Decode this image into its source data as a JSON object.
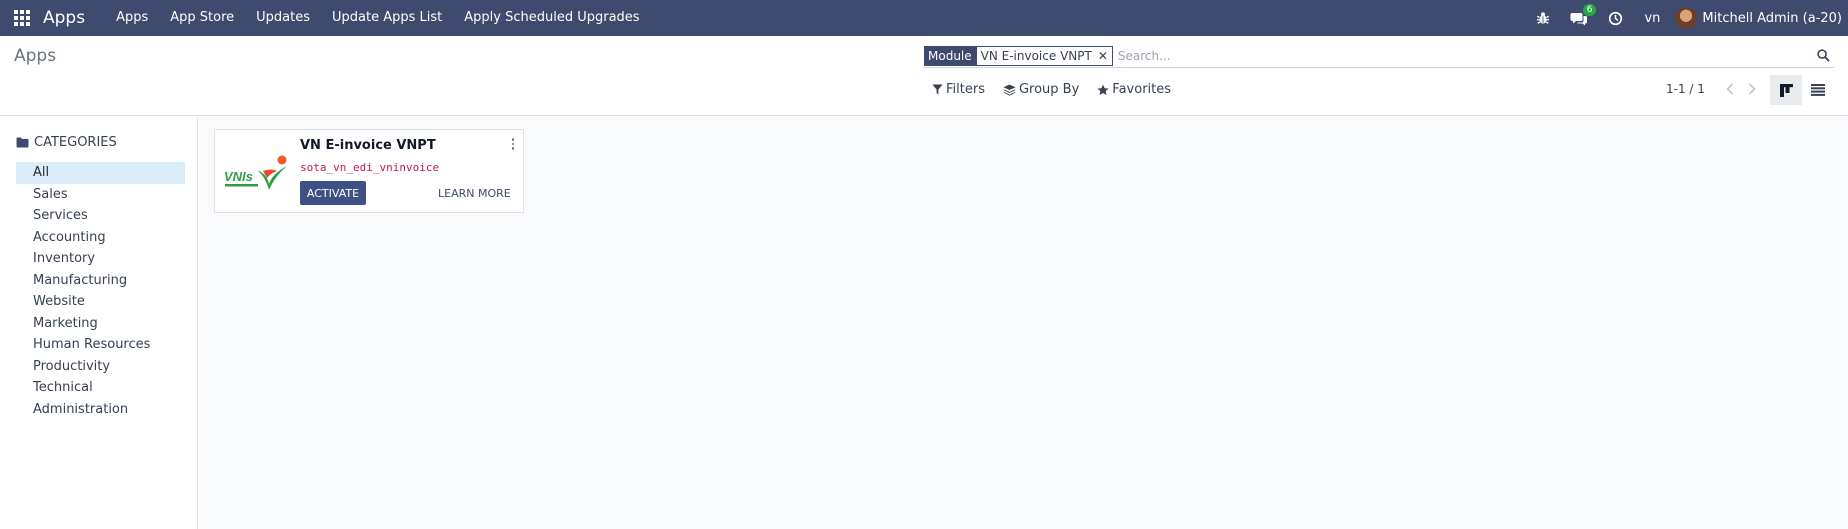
{
  "navbar": {
    "brand": "Apps",
    "menu": [
      "Apps",
      "App Store",
      "Updates",
      "Update Apps List",
      "Apply Scheduled Upgrades"
    ],
    "messages_badge": "6",
    "lang": "vn",
    "user_name": "Mitchell Admin (a-20)",
    "icons": [
      "app-grid-icon",
      "bug-icon",
      "chat-icon",
      "clock-icon"
    ]
  },
  "control": {
    "page_title": "Apps",
    "facet_label": "Module",
    "facet_value": "VN E-invoice VNPT",
    "search_placeholder": "Search...",
    "filters_label": "Filters",
    "groupby_label": "Group By",
    "favorites_label": "Favorites",
    "pager_value": "1-1 / 1"
  },
  "sidebar": {
    "header": "CATEGORIES",
    "items": [
      {
        "label": "All",
        "active": true
      },
      {
        "label": "Sales"
      },
      {
        "label": "Services"
      },
      {
        "label": "Accounting"
      },
      {
        "label": "Inventory"
      },
      {
        "label": "Manufacturing"
      },
      {
        "label": "Website"
      },
      {
        "label": "Marketing"
      },
      {
        "label": "Human Resources"
      },
      {
        "label": "Productivity"
      },
      {
        "label": "Technical"
      },
      {
        "label": "Administration"
      }
    ]
  },
  "apps": [
    {
      "name": "VN E-invoice VNPT",
      "technical_name": "sota_vn_edi_vninvoice",
      "logo_text": "VNIs",
      "activate_label": "ACTIVATE",
      "learn_more_label": "LEARN MORE"
    }
  ],
  "colors": {
    "navbar": "#3e4a6e",
    "primary_button": "#3e5185",
    "technical_name": "#c2185b",
    "active_category": "#d9ecf8",
    "badge": "#28a745"
  }
}
